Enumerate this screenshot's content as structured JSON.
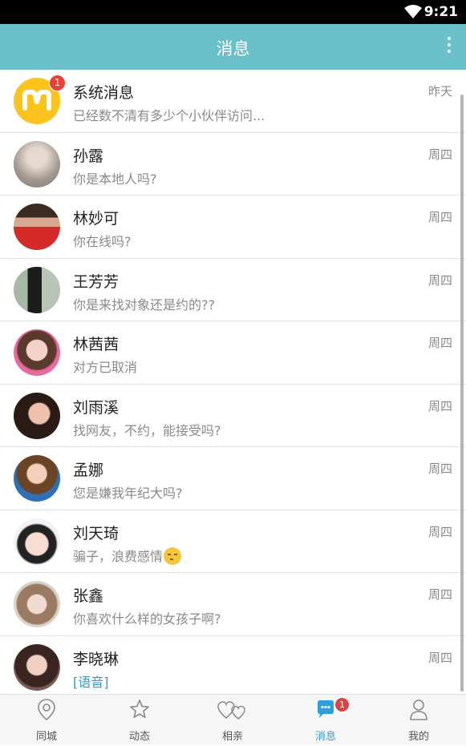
{
  "status_bar": {
    "time": "9:21",
    "wifi_icon": "wifi-icon"
  },
  "app_bar": {
    "title": "消息",
    "more_icon": "more-vertical-icon"
  },
  "conversations": [
    {
      "name": "系统消息",
      "message": "已经数不清有多少个小伙伴访问...",
      "time": "昨天",
      "badge": "1",
      "avatar": "system-logo"
    },
    {
      "name": "孙露",
      "message": "你是本地人吗?",
      "time": "周四"
    },
    {
      "name": "林妙可",
      "message": "你在线吗?",
      "time": "周四"
    },
    {
      "name": "王芳芳",
      "message": "你是来找对象还是约的??",
      "time": "周四"
    },
    {
      "name": "林茜茜",
      "message": "对方已取消",
      "time": "周四"
    },
    {
      "name": "刘雨溪",
      "message": "找网友，不约，能接受吗?",
      "time": "周四"
    },
    {
      "name": "孟娜",
      "message": "您是嫌我年纪大吗?",
      "time": "周四"
    },
    {
      "name": "刘天琦",
      "message": "骗子，浪费感情",
      "emoji": "unamused-face-emoji",
      "time": "周四"
    },
    {
      "name": "张鑫",
      "message": "你喜欢什么样的女孩子啊?",
      "time": "周四"
    },
    {
      "name": "李晓琳",
      "message": "[语音]",
      "time": "周四"
    }
  ],
  "tabs": [
    {
      "label": "同城",
      "icon": "location-pin-icon"
    },
    {
      "label": "动态",
      "icon": "star-icon"
    },
    {
      "label": "相亲",
      "icon": "hearts-icon"
    },
    {
      "label": "消息",
      "icon": "chat-bubble-icon",
      "badge": "1",
      "active": true
    },
    {
      "label": "我的",
      "icon": "person-icon"
    }
  ],
  "colors": {
    "app_bar": "#6ac0c8",
    "active_tab": "#2e9fd8",
    "badge": "#e8413c",
    "logo": "#fcc31f"
  }
}
